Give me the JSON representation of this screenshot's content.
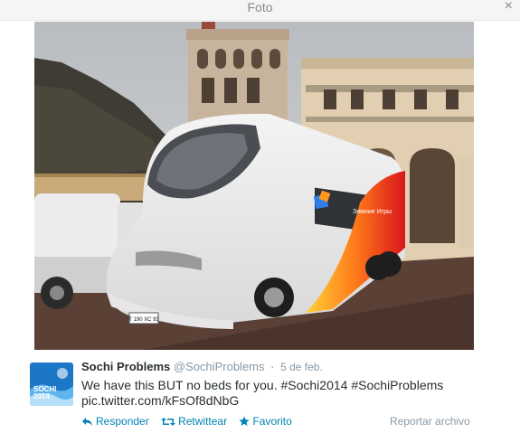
{
  "window": {
    "title": "Foto",
    "close_glyph": "×"
  },
  "photo": {
    "plate_text": "Т 190 ХС 93",
    "decal_text": "Зимние Игры"
  },
  "tweet": {
    "avatar_text": "SOCHI\n2014",
    "name": "Sochi Problems",
    "handle": "@SochiProblems",
    "separator": "·",
    "date": "5 de feb.",
    "text": "We have this BUT no beds for you. #Sochi2014 #SochiProblems",
    "link": "pic.twitter.com/kFsOf8dNbG",
    "actions": {
      "reply": "Responder",
      "retweet": "Retwittear",
      "favorite": "Favorito"
    },
    "report": "Reportar archivo"
  },
  "colors": {
    "link_blue": "#0084b4",
    "muted_gray": "#8899a6",
    "text_dark": "#292f33",
    "favorite_star": "#0084b4"
  },
  "icons": {
    "reply": "reply-arrow-icon",
    "retweet": "retweet-icon",
    "favorite": "star-icon",
    "close": "close-icon"
  }
}
